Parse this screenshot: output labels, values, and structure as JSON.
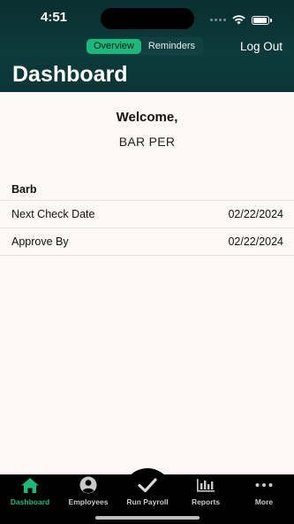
{
  "status_bar": {
    "time": "4:51"
  },
  "header": {
    "segments": [
      {
        "label": "Overview",
        "active": true
      },
      {
        "label": "Reminders",
        "active": false
      }
    ],
    "logout_label": "Log Out",
    "title": "Dashboard"
  },
  "welcome": {
    "greeting": "Welcome,",
    "user_name": "BAR PER"
  },
  "company": {
    "name": "Barb",
    "rows": [
      {
        "label": "Next Check Date",
        "value": "02/22/2024"
      },
      {
        "label": "Approve By",
        "value": "02/22/2024"
      }
    ]
  },
  "tabbar": {
    "tabs": [
      {
        "label": "Dashboard",
        "icon": "home-icon",
        "active": true
      },
      {
        "label": "Employees",
        "icon": "person-icon",
        "active": false
      },
      {
        "label": "Run Payroll",
        "icon": "checkmark-icon",
        "active": false
      },
      {
        "label": "Reports",
        "icon": "bar-chart-icon",
        "active": false
      },
      {
        "label": "More",
        "icon": "more-dots-icon",
        "active": false
      }
    ]
  },
  "colors": {
    "header_bg": "#0d3a3b",
    "accent": "#1fb87a",
    "content_bg": "#fdf8f5",
    "tabbar_bg": "#000000"
  }
}
